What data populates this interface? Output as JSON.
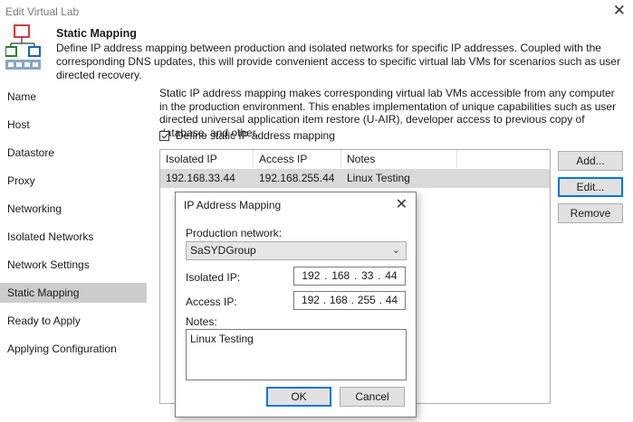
{
  "window": {
    "title": "Edit Virtual Lab",
    "close_glyph": "✕"
  },
  "header": {
    "title": "Static Mapping",
    "description": "Define IP address mapping between production and isolated networks for specific IP addresses. Coupled with the corresponding DNS updates, this will provide convenient access to specific virtual lab VMs for scenarios such as user directed recovery.",
    "icon": "virtual-lab-network-icon"
  },
  "sidebar": {
    "items": [
      {
        "label": "Name"
      },
      {
        "label": "Host"
      },
      {
        "label": "Datastore"
      },
      {
        "label": "Proxy"
      },
      {
        "label": "Networking"
      },
      {
        "label": "Isolated Networks"
      },
      {
        "label": "Network Settings"
      },
      {
        "label": "Static Mapping",
        "active": true
      },
      {
        "label": "Ready to Apply"
      },
      {
        "label": "Applying Configuration"
      }
    ]
  },
  "main": {
    "description": "Static IP address mapping makes corresponding virtual lab VMs accessible from any computer in the production environment. This enables implementation of unique capabilities such as user directed universal application item restore (U-AIR), developer access to previous copy of database, and other.",
    "checkbox_label": "Define static IP address mapping",
    "checkbox_checked": true,
    "table": {
      "columns": [
        "Isolated IP",
        "Access IP",
        "Notes"
      ],
      "rows": [
        {
          "isolated_ip": "192.168.33.44",
          "access_ip": "192.168.255.44",
          "notes": "Linux Testing"
        }
      ]
    },
    "buttons": {
      "add": "Add...",
      "edit": "Edit...",
      "remove": "Remove"
    }
  },
  "dialog": {
    "title": "IP Address Mapping",
    "close_glyph": "✕",
    "production_network_label": "Production network:",
    "production_network_value": "SaSYDGroup",
    "isolated_ip_label": "Isolated IP:",
    "isolated_ip": [
      "192",
      "168",
      "33",
      "44"
    ],
    "access_ip_label": "Access IP:",
    "access_ip": [
      "192",
      "168",
      "255",
      "44"
    ],
    "notes_label": "Notes:",
    "notes_value": "Linux Testing",
    "ok": "OK",
    "cancel": "Cancel",
    "ip_separator": "."
  },
  "colors": {
    "accent": "#0078d7",
    "selected_row": "#d9d9d9",
    "active_nav": "#cccccc"
  }
}
